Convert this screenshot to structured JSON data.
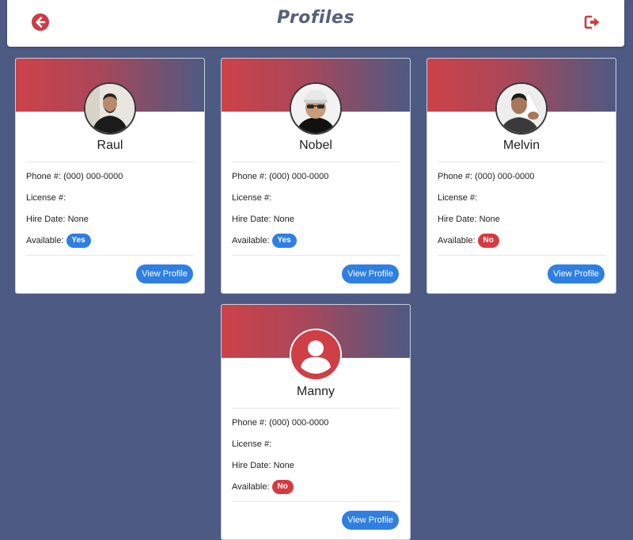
{
  "header": {
    "title": "Profiles",
    "back_icon": "arrow-left-circle-icon",
    "logout_icon": "sign-out-icon"
  },
  "colors": {
    "background": "#4c5a84",
    "accent_red": "#cd4249",
    "button_blue": "#2f7fe3",
    "badge_no": "#d63a41"
  },
  "labels": {
    "phone": "Phone #:",
    "license": "License #:",
    "hire_date": "Hire Date:",
    "available": "Available:",
    "view_profile": "View Profile"
  },
  "profiles": [
    {
      "name": "Raul",
      "phone": "(000) 000-0000",
      "license": "",
      "hire_date": "None",
      "available": "Yes",
      "avatar": "photo"
    },
    {
      "name": "Nobel",
      "phone": "(000) 000-0000",
      "license": "",
      "hire_date": "None",
      "available": "Yes",
      "avatar": "photo"
    },
    {
      "name": "Melvin",
      "phone": "(000) 000-0000",
      "license": "",
      "hire_date": "None",
      "available": "No",
      "avatar": "photo"
    },
    {
      "name": "Manny",
      "phone": "(000) 000-0000",
      "license": "",
      "hire_date": "None",
      "available": "No",
      "avatar": "default-user-icon"
    }
  ]
}
